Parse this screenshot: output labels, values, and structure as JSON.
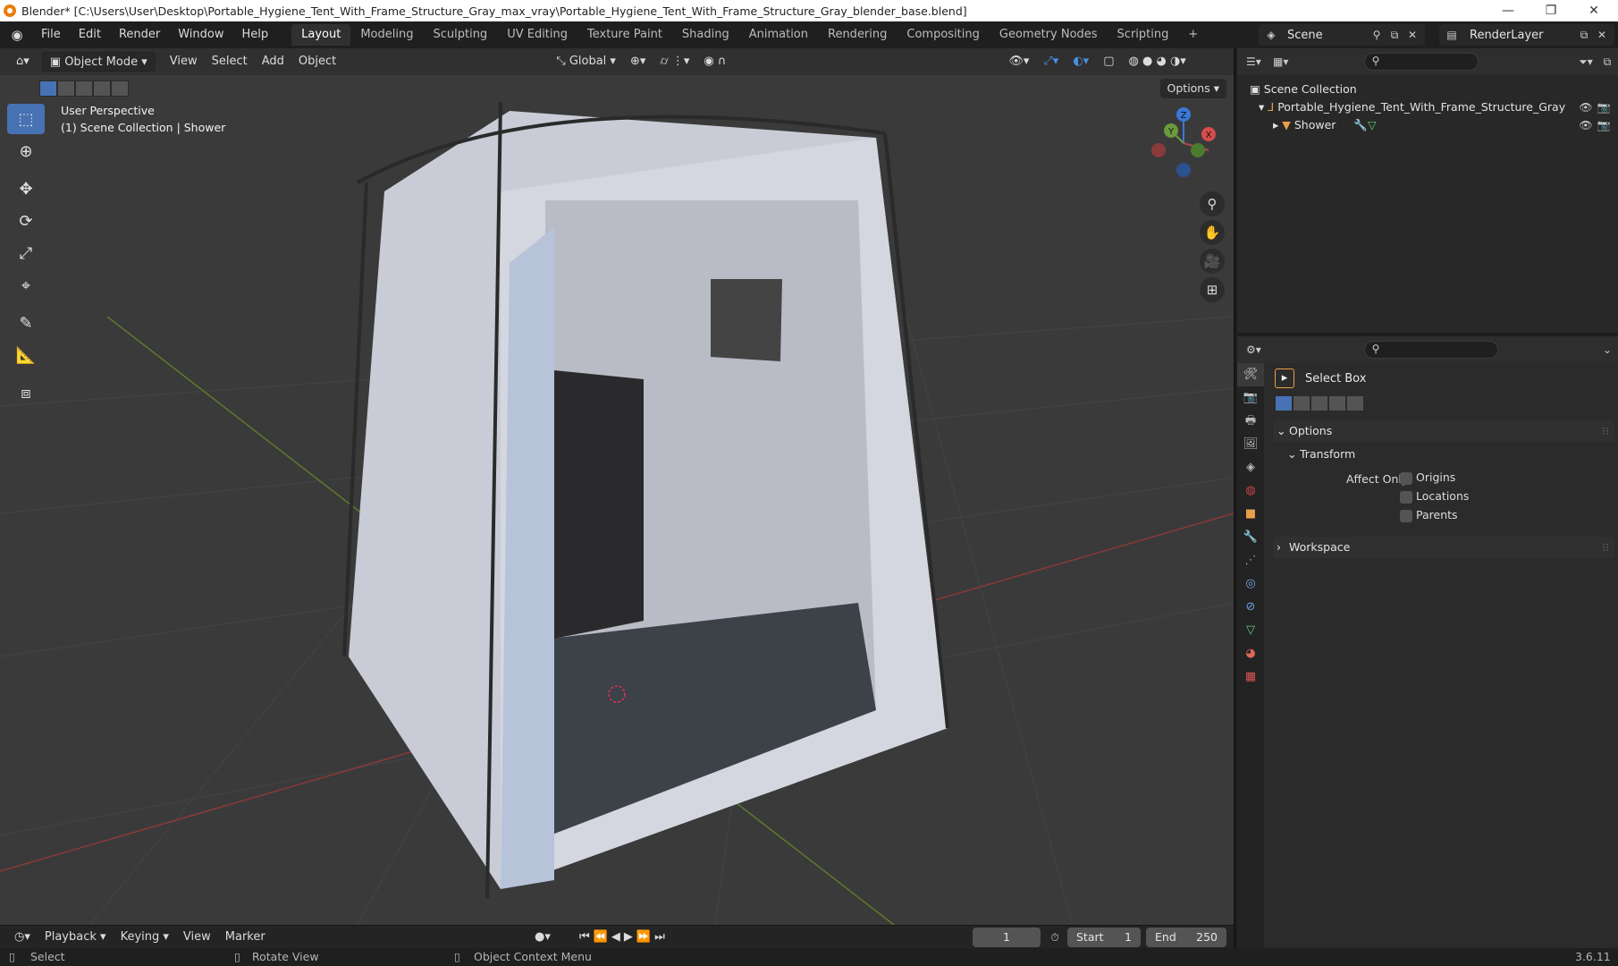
{
  "window": {
    "title": "Blender* [C:\\Users\\User\\Desktop\\Portable_Hygiene_Tent_With_Frame_Structure_Gray_max_vray\\Portable_Hygiene_Tent_With_Frame_Structure_Gray_blender_base.blend]",
    "minimize": "—",
    "restore": "❐",
    "close": "✕"
  },
  "menubar": {
    "items": [
      "File",
      "Edit",
      "Render",
      "Window",
      "Help"
    ],
    "workspaces": [
      "Layout",
      "Modeling",
      "Sculpting",
      "UV Editing",
      "Texture Paint",
      "Shading",
      "Animation",
      "Rendering",
      "Compositing",
      "Geometry Nodes",
      "Scripting"
    ],
    "active_workspace": "Layout",
    "add_tab": "+",
    "scene": "Scene",
    "render_layer": "RenderLayer"
  },
  "viewport": {
    "mode": "Object Mode",
    "menus": [
      "View",
      "Select",
      "Add",
      "Object"
    ],
    "orientation": "Global",
    "options": "Options",
    "info_line1": "User Perspective",
    "info_line2": "(1) Scene Collection | Shower",
    "gizmo_axes": [
      "Z",
      "Y",
      "X"
    ]
  },
  "toolbar": {
    "tools": [
      "select-box",
      "cursor",
      "move",
      "rotate",
      "scale",
      "transform",
      "annotate",
      "measure",
      "add-cube"
    ]
  },
  "outliner": {
    "root": "Scene Collection",
    "collection": "Portable_Hygiene_Tent_With_Frame_Structure_Gray",
    "object": "Shower"
  },
  "properties": {
    "tool_name": "Select Box",
    "panel_options": "Options",
    "panel_transform": "Transform",
    "affect_only": "Affect Only",
    "checkboxes": [
      "Origins",
      "Locations",
      "Parents"
    ],
    "panel_workspace": "Workspace"
  },
  "timeline": {
    "menus": [
      "Playback",
      "Keying",
      "View",
      "Marker"
    ],
    "current_frame": "1",
    "start_label": "Start",
    "start": "1",
    "end_label": "End",
    "end": "250"
  },
  "statusbar": {
    "select": "Select",
    "rotate": "Rotate View",
    "context": "Object Context Menu",
    "version": "3.6.11"
  },
  "colors": {
    "accent": "#4772b3",
    "viewport_bg": "#3a3a3a",
    "panel_bg": "#2b2b2b"
  }
}
